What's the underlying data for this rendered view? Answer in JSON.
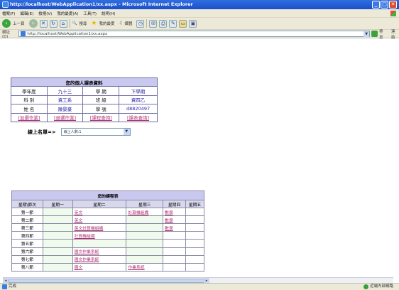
{
  "window": {
    "title": "http://localhost/WebApplication1/xx.aspx - Microsoft Internet Explorer",
    "buttons": [
      "_",
      "□",
      "✕"
    ]
  },
  "menu": [
    "檔案(F)",
    "編輯(E)",
    "檢視(V)",
    "我的最愛(A)",
    "工具(T)",
    "說明(H)"
  ],
  "toolbar": {
    "back": "上一頁",
    "search": "搜尋",
    "favorites": "我的最愛",
    "media": "媒體"
  },
  "address": {
    "label": "網址(D)",
    "url": "http://localhost/WebApplication1/xx.aspx",
    "go": "移至",
    "links": "連結"
  },
  "info": {
    "title": "您的個人課表資料",
    "rows": [
      {
        "l1": "學年度",
        "v1": "九十三",
        "l2": "學 期",
        "v2": "下學期"
      },
      {
        "l1": "科 別",
        "v1": "資工系",
        "l2": "班 級",
        "v2": "資四乙"
      },
      {
        "l1": "姓 名",
        "v1": "陳景豪",
        "l2": "學 號",
        "v2": "d8820497"
      }
    ],
    "links": [
      "[加選作業]",
      "[退選作業]",
      "[課程查詢]",
      "[課表查詢]"
    ]
  },
  "online": {
    "label": "線上名單=>",
    "selected": "線上人數:1"
  },
  "schedule": {
    "title": "您的課程表",
    "headers": [
      "星期\\節次",
      "星期一",
      "星期二",
      "星期三",
      "星期四",
      "星期五"
    ],
    "rows": [
      {
        "period": "第一節",
        "mon": "",
        "tue": "英文",
        "wed": "計算機組織",
        "thu": "數學",
        "fri": ""
      },
      {
        "period": "第二節",
        "mon": "",
        "tue": "英文",
        "wed": "",
        "thu": "數學",
        "fri": ""
      },
      {
        "period": "第三節",
        "mon": "",
        "tue": "英文計算機組織",
        "wed": "",
        "thu": "數學",
        "fri": ""
      },
      {
        "period": "第四節",
        "mon": "",
        "tue": "計算機組織",
        "wed": "",
        "thu": "",
        "fri": ""
      },
      {
        "period": "第五節",
        "mon": "",
        "tue": "",
        "wed": "",
        "thu": "",
        "fri": ""
      },
      {
        "period": "第六節",
        "mon": "",
        "tue": "國文作業系統",
        "wed": "",
        "thu": "",
        "fri": ""
      },
      {
        "period": "第七節",
        "mon": "",
        "tue": "國文作業系統",
        "wed": "",
        "thu": "",
        "fri": ""
      },
      {
        "period": "第八節",
        "mon": "",
        "tue": "國文",
        "wed": "作業系統",
        "thu": "",
        "fri": ""
      }
    ]
  },
  "status": {
    "left": "完成",
    "zone": "近端內部網路"
  },
  "colors": {
    "titlebar": "#1a4fc9",
    "table_header": "#c9c9ef",
    "link": "#b23070",
    "value": "#2424a8"
  }
}
